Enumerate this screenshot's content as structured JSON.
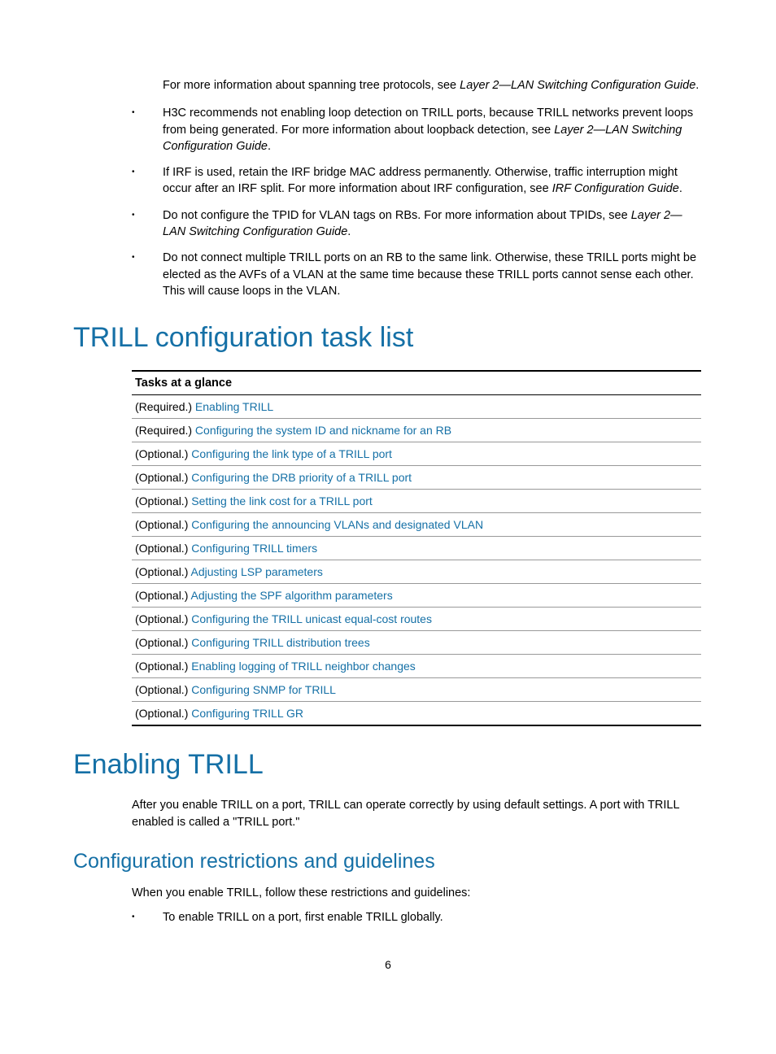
{
  "continuation": {
    "text": "For more information about spanning tree protocols, see ",
    "ref": "Layer 2—LAN Switching Configuration Guide",
    "tail": "."
  },
  "bullets": [
    {
      "pre": "H3C recommends not enabling loop detection on TRILL ports, because TRILL networks prevent loops from being generated. For more information about loopback detection, see ",
      "ref": "Layer 2—LAN Switching Configuration Guide",
      "tail": "."
    },
    {
      "pre": "If IRF is used, retain the IRF bridge MAC address permanently. Otherwise, traffic interruption might occur after an IRF split. For more information about IRF configuration, see ",
      "ref": "IRF Configuration Guide",
      "tail": "."
    },
    {
      "pre": "Do not configure the TPID for VLAN tags on RBs. For more information about TPIDs, see ",
      "ref": "Layer 2—LAN Switching Configuration Guide",
      "tail": "."
    },
    {
      "pre": "Do not connect multiple TRILL ports on an RB to the same link. Otherwise, these TRILL ports might be elected as the AVFs of a VLAN at the same time because these TRILL ports cannot sense each other. This will cause loops in the VLAN.",
      "ref": "",
      "tail": ""
    }
  ],
  "heading_tasklist": "TRILL configuration task list",
  "table_header": "Tasks at a glance",
  "tasks": [
    {
      "prefix": "(Required.) ",
      "link": "Enabling TRILL"
    },
    {
      "prefix": "(Required.) ",
      "link": "Configuring the system ID and nickname for an RB"
    },
    {
      "prefix": "(Optional.) ",
      "link": "Configuring the link type of a TRILL port"
    },
    {
      "prefix": "(Optional.) ",
      "link": "Configuring the DRB priority of a TRILL port"
    },
    {
      "prefix": "(Optional.) ",
      "link": "Setting the link cost for a TRILL port"
    },
    {
      "prefix": "(Optional.) ",
      "link": "Configuring the announcing VLANs and designated VLAN"
    },
    {
      "prefix": "(Optional.) ",
      "link": "Configuring TRILL timers"
    },
    {
      "prefix": "(Optional.) ",
      "link": "Adjusting LSP parameters"
    },
    {
      "prefix": "(Optional.) ",
      "link": "Adjusting the SPF algorithm parameters"
    },
    {
      "prefix": "(Optional.) ",
      "link": "Configuring the TRILL unicast equal-cost routes"
    },
    {
      "prefix": "(Optional.) ",
      "link": "Configuring TRILL distribution trees"
    },
    {
      "prefix": "(Optional.) ",
      "link": "Enabling logging of TRILL neighbor changes"
    },
    {
      "prefix": "(Optional.) ",
      "link": "Configuring SNMP for TRILL"
    },
    {
      "prefix": "(Optional.) ",
      "link": "Configuring TRILL GR"
    }
  ],
  "heading_enabling": "Enabling TRILL",
  "enabling_para": "After you enable TRILL on a port, TRILL can operate correctly by using default settings. A port with TRILL enabled is called a \"TRILL port.\"",
  "heading_restrictions": "Configuration restrictions and guidelines",
  "restrictions_para": "When you enable TRILL, follow these restrictions and guidelines:",
  "restrictions_bullet": "To enable TRILL on a port, first enable TRILL globally.",
  "pagenum": "6"
}
